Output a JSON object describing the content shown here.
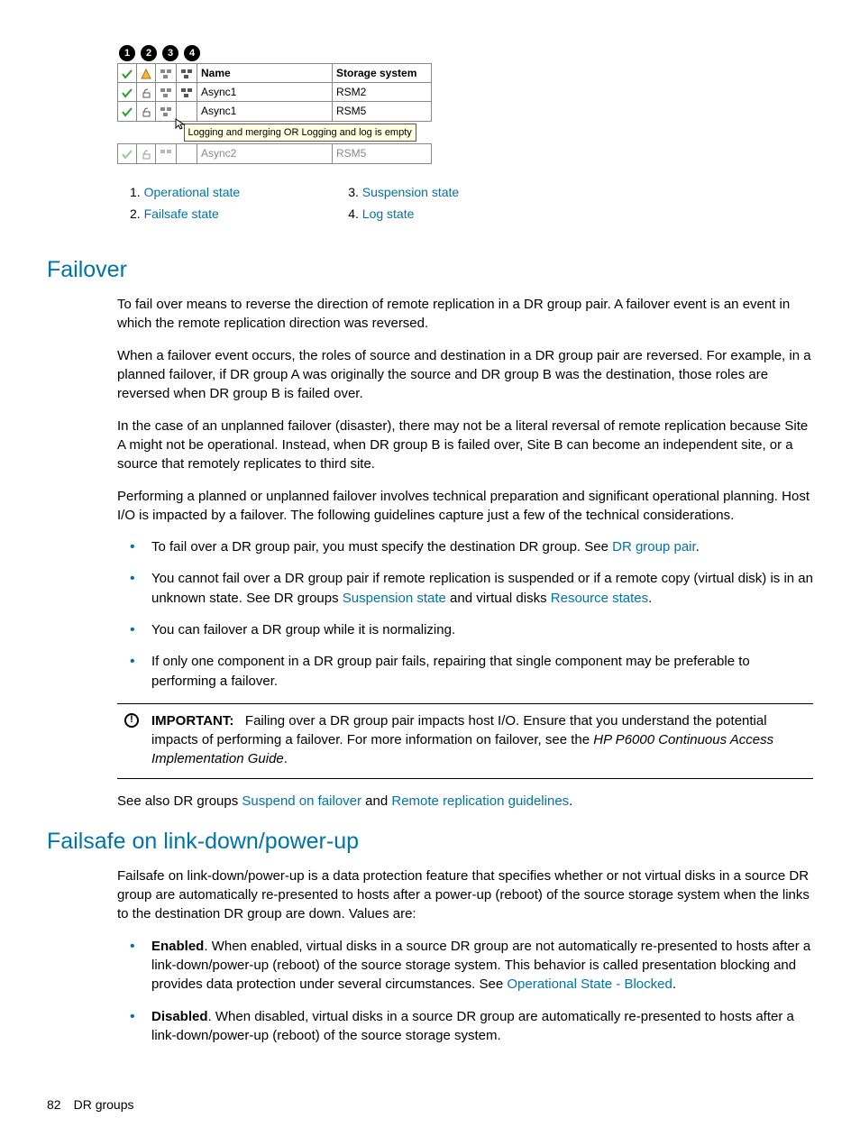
{
  "callouts": {
    "c1": "1",
    "c2": "2",
    "c3": "3",
    "c4": "4"
  },
  "ui_table": {
    "header_name": "Name",
    "header_system": "Storage system",
    "r1_name": "Async1",
    "r1_system": "RSM2",
    "r2_name": "Async1",
    "r2_system": "RSM5",
    "tooltip": "Logging and merging OR Logging and log is empty",
    "r3_name": "Async2",
    "r3_system": "RSM5"
  },
  "legend": {
    "l1_num": "1. ",
    "l1": "Operational state",
    "l2_num": "2. ",
    "l2": "Failsafe state",
    "l3_num": "3. ",
    "l3": "Suspension state",
    "l4_num": "4. ",
    "l4": "Log state"
  },
  "section_failover": {
    "heading": "Failover",
    "p1": "To fail over means to reverse the direction of remote replication in a DR group pair. A failover event is an event in which the remote replication direction was reversed.",
    "p2": "When a failover event occurs, the roles of source and destination in a DR group pair are reversed. For example, in a planned failover, if DR group A was originally the source and DR group B was the destination, those roles are reversed when DR group B is failed over.",
    "p3": "In the case of an unplanned failover (disaster), there may not be a literal reversal of remote replication because Site A might not be operational. Instead, when DR group B is failed over, Site B can become an independent site, or a source that remotely replicates to third site.",
    "p4": "Performing a planned or unplanned failover involves technical preparation and significant operational planning. Host I/O is impacted by a failover. The following guidelines capture just a few of the technical considerations.",
    "b1_a": "To fail over a DR group pair, you must specify the destination DR group. See ",
    "b1_link": "DR group pair",
    "b1_b": ".",
    "b2_a": "You cannot fail over a DR group pair if remote replication is suspended or if a remote copy (virtual disk) is in an unknown state. See DR groups ",
    "b2_link1": "Suspension state",
    "b2_b": " and virtual disks ",
    "b2_link2": "Resource states",
    "b2_c": ".",
    "b3": "You can failover a DR group while it is normalizing.",
    "b4": "If only one component in a DR group pair fails, repairing that single component may be preferable to performing a failover.",
    "important_label": "IMPORTANT:",
    "important_a": "Failing over a DR group pair impacts host I/O. Ensure that you understand the potential impacts of performing a failover. For more information on failover, see the ",
    "important_ital": "HP P6000 Continuous Access Implementation Guide",
    "important_b": ".",
    "p5_a": "See also DR groups ",
    "p5_link1": "Suspend on failover",
    "p5_b": " and ",
    "p5_link2": "Remote replication guidelines",
    "p5_c": "."
  },
  "section_failsafe": {
    "heading": "Failsafe on link-down/power-up",
    "p1": "Failsafe on link-down/power-up is a data protection feature that specifies whether or not virtual disks in a source DR group are automatically re-presented to hosts after a power-up (reboot) of the source storage system when the links to the destination DR group are down. Values are:",
    "b1_label": "Enabled",
    "b1_a": ". When enabled, virtual disks in a source DR group are not automatically re-presented to hosts after a link-down/power-up (reboot) of the source storage system. This behavior is called presentation blocking and provides data protection under several circumstances. See ",
    "b1_link": "Operational State - Blocked",
    "b1_b": ".",
    "b2_label": "Disabled",
    "b2": ". When disabled, virtual disks in a source DR group are automatically re-presented to hosts after a link-down/power-up (reboot) of the source storage system."
  },
  "footer": {
    "page_num": "82",
    "section": "DR groups"
  }
}
